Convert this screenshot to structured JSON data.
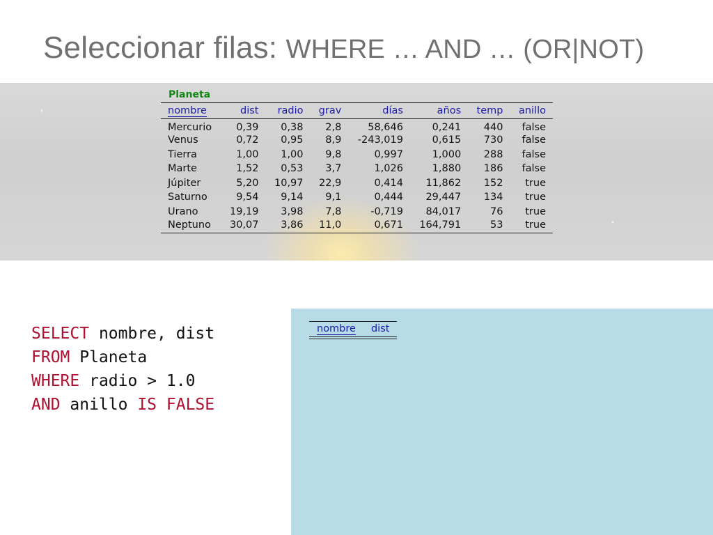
{
  "title": {
    "text_part": "Seleccionar filas: ",
    "code_part": "WHERE … AND … (OR|NOT)"
  },
  "planet_table": {
    "name": "Planeta",
    "columns": [
      "nombre",
      "dist",
      "radio",
      "grav",
      "días",
      "años",
      "temp",
      "anillo"
    ],
    "rows": [
      [
        "Mercurio",
        "0,39",
        "0,38",
        "2,8",
        "58,646",
        "0,241",
        "440",
        "false"
      ],
      [
        "Venus",
        "0,72",
        "0,95",
        "8,9",
        "-243,019",
        "0,615",
        "730",
        "false"
      ],
      [
        "Tierra",
        "1,00",
        "1,00",
        "9,8",
        "0,997",
        "1,000",
        "288",
        "false"
      ],
      [
        "Marte",
        "1,52",
        "0,53",
        "3,7",
        "1,026",
        "1,880",
        "186",
        "false"
      ],
      [
        "Júpiter",
        "5,20",
        "10,97",
        "22,9",
        "0,414",
        "11,862",
        "152",
        "true"
      ],
      [
        "Saturno",
        "9,54",
        "9,14",
        "9,1",
        "0,444",
        "29,447",
        "134",
        "true"
      ],
      [
        "Urano",
        "19,19",
        "3,98",
        "7,8",
        "-0,719",
        "84,017",
        "76",
        "true"
      ],
      [
        "Neptuno",
        "30,07",
        "3,86",
        "11,0",
        "0,671",
        "164,791",
        "53",
        "true"
      ]
    ]
  },
  "sql": {
    "line1_kw": "SELECT",
    "line1_rest": " nombre, dist",
    "line2_kw": "FROM",
    "line2_rest": " Planeta",
    "line3_kw": "WHERE",
    "line3_rest": " radio > 1.0",
    "line4_kw": "AND",
    "line4_mid": " anillo ",
    "line4_kw2": "IS FALSE"
  },
  "result_table": {
    "columns": [
      "nombre",
      "dist"
    ]
  },
  "colors": {
    "keyword": "#b01030",
    "header": "#1a1aa6",
    "table_name": "#138a13",
    "result_bg": "#b7dce8"
  }
}
